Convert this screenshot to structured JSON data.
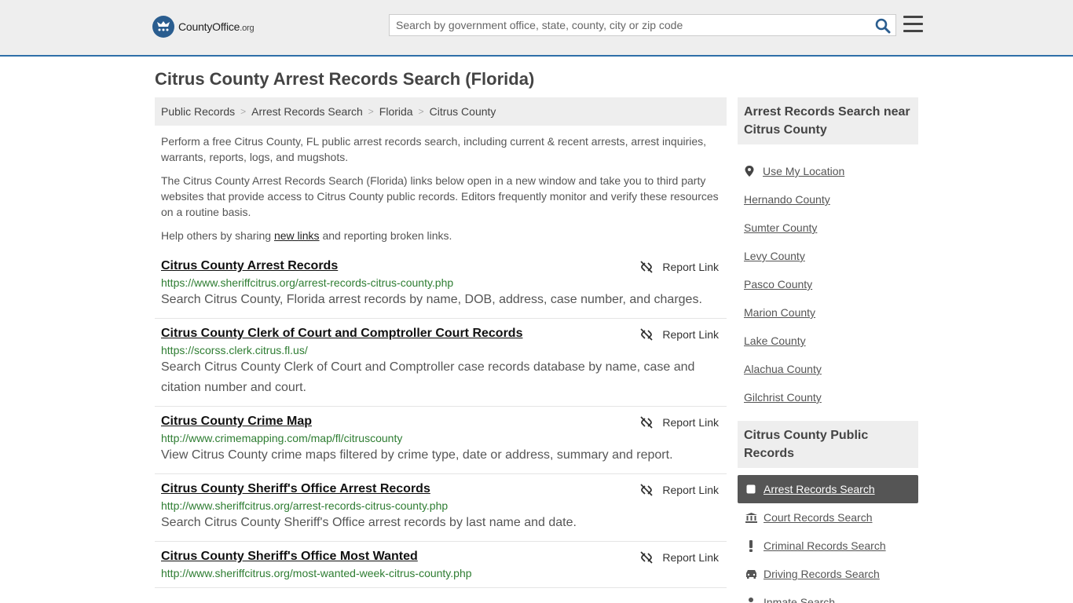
{
  "header": {
    "logo_text_main": "CountyOffice",
    "logo_text_org": ".org",
    "search_placeholder": "Search by government office, state, county, city or zip code"
  },
  "page_title": "Citrus County Arrest Records Search (Florida)",
  "breadcrumb": [
    "Public Records",
    "Arrest Records Search",
    "Florida",
    "Citrus County"
  ],
  "intro": {
    "p1": "Perform a free Citrus County, FL public arrest records search, including current & recent arrests, arrest inquiries, warrants, reports, logs, and mugshots.",
    "p2": "The Citrus County Arrest Records Search (Florida) links below open in a new window and take you to third party websites that provide access to Citrus County public records. Editors frequently monitor and verify these resources on a routine basis.",
    "p3_before": "Help others by sharing ",
    "p3_link": "new links",
    "p3_after": " and reporting broken links."
  },
  "report_label": "Report Link",
  "results": [
    {
      "title": "Citrus County Arrest Records",
      "url": "https://www.sheriffcitrus.org/arrest-records-citrus-county.php",
      "desc": "Search Citrus County, Florida arrest records by name, DOB, address, case number, and charges."
    },
    {
      "title": "Citrus County Clerk of Court and Comptroller Court Records",
      "url": "https://scorss.clerk.citrus.fl.us/",
      "desc": "Search Citrus County Clerk of Court and Comptroller case records database by name, case and citation number and court."
    },
    {
      "title": "Citrus County Crime Map",
      "url": "http://www.crimemapping.com/map/fl/citruscounty",
      "desc": "View Citrus County crime maps filtered by crime type, date or address, summary and report."
    },
    {
      "title": "Citrus County Sheriff's Office Arrest Records",
      "url": "http://www.sheriffcitrus.org/arrest-records-citrus-county.php",
      "desc": "Search Citrus County Sheriff's Office arrest records by last name and date."
    },
    {
      "title": "Citrus County Sheriff's Office Most Wanted",
      "url": "http://www.sheriffcitrus.org/most-wanted-week-citrus-county.php",
      "desc": ""
    }
  ],
  "sidebar": {
    "near_title": "Arrest Records Search near Citrus County",
    "use_location": "Use My Location",
    "near_items": [
      "Hernando County",
      "Sumter County",
      "Levy County",
      "Pasco County",
      "Marion County",
      "Lake County",
      "Alachua County",
      "Gilchrist County"
    ],
    "public_title": "Citrus County Public Records",
    "public_items": [
      {
        "label": "Arrest Records Search",
        "icon": "square-icon",
        "active": true
      },
      {
        "label": "Court Records Search",
        "icon": "courthouse-icon",
        "active": false
      },
      {
        "label": "Criminal Records Search",
        "icon": "exclamation-icon",
        "active": false
      },
      {
        "label": "Driving Records Search",
        "icon": "car-icon",
        "active": false
      },
      {
        "label": "Inmate Search",
        "icon": "inmate-icon",
        "active": false
      }
    ]
  },
  "colors": {
    "accent": "#2e6fa8",
    "url_green": "#2e7d32",
    "active_bg": "#555555"
  }
}
